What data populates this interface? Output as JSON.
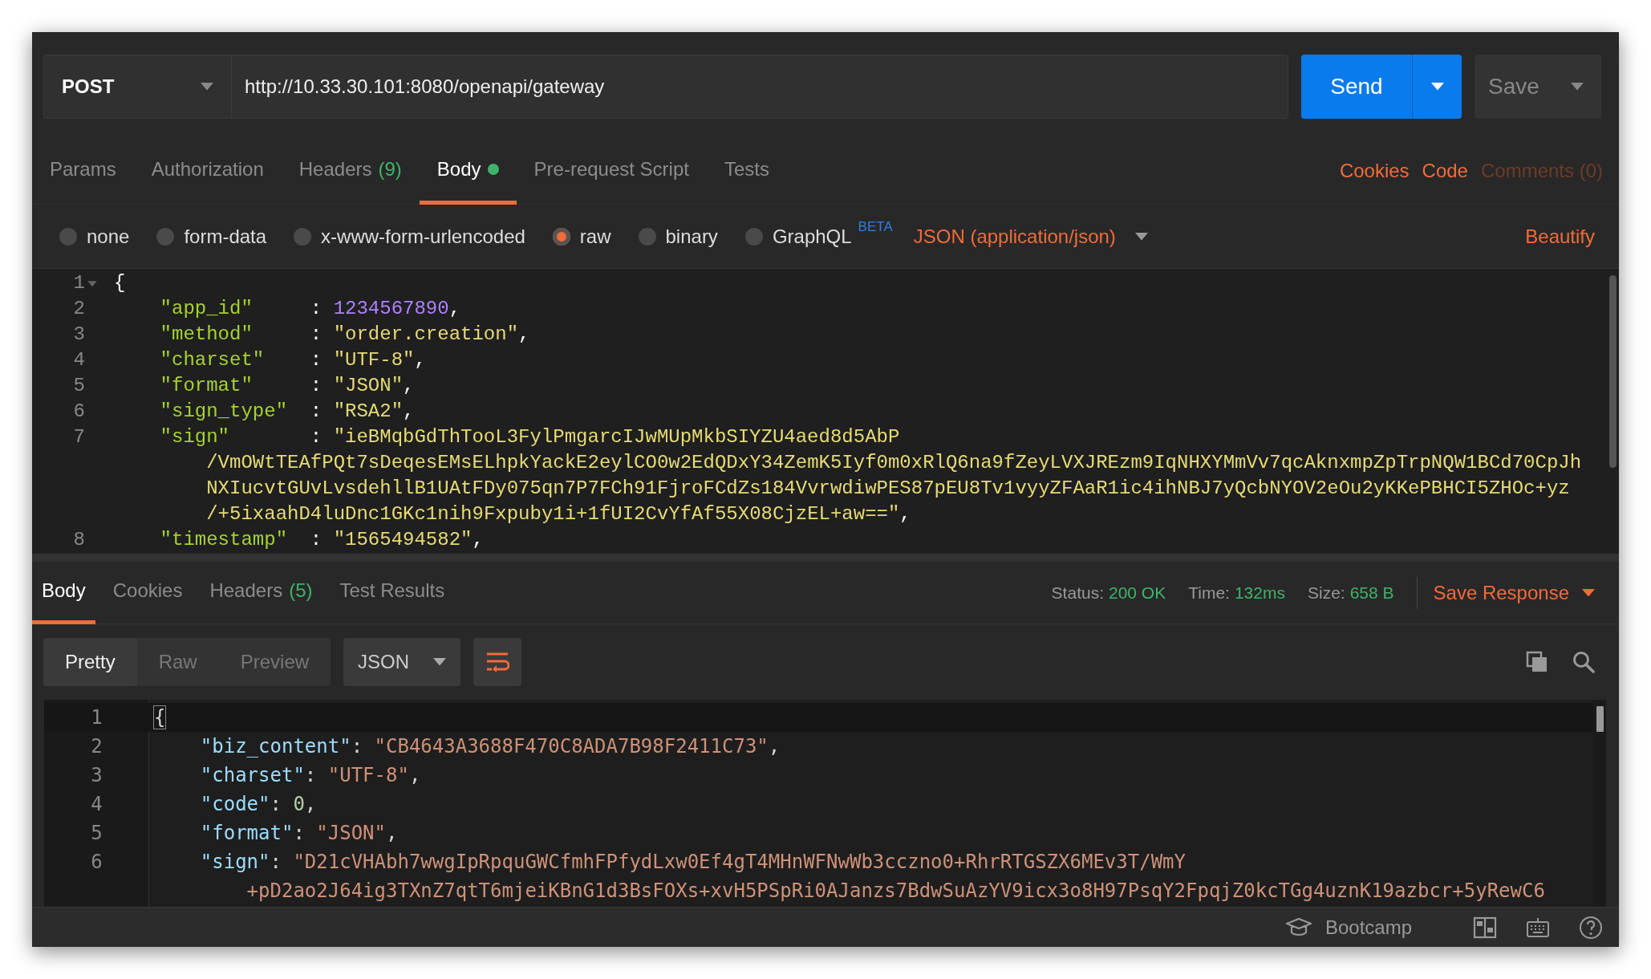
{
  "request": {
    "method": "POST",
    "url": "http://10.33.30.101:8080/openapi/gateway",
    "send": "Send",
    "save": "Save"
  },
  "request_tabs": [
    {
      "label": "Params",
      "selected": false
    },
    {
      "label": "Authorization",
      "selected": false
    },
    {
      "label": "Headers",
      "count": "(9)",
      "selected": false
    },
    {
      "label": "Body",
      "indicator": true,
      "selected": true
    },
    {
      "label": "Pre-request Script",
      "selected": false
    },
    {
      "label": "Tests",
      "selected": false
    }
  ],
  "request_links": [
    {
      "label": "Cookies",
      "disabled": false
    },
    {
      "label": "Code",
      "disabled": false
    },
    {
      "label": "Comments (0)",
      "disabled": true
    }
  ],
  "body_modes": [
    {
      "label": "none",
      "selected": false
    },
    {
      "label": "form-data",
      "selected": false
    },
    {
      "label": "x-www-form-urlencoded",
      "selected": false
    },
    {
      "label": "raw",
      "selected": true
    },
    {
      "label": "binary",
      "selected": false
    },
    {
      "label": "GraphQL",
      "badge": "BETA",
      "selected": false
    }
  ],
  "content_type": "JSON (application/json)",
  "beautify": "Beautify",
  "request_body": [
    {
      "number": "1",
      "foldable": true,
      "tokens": [
        {
          "kind": "brace",
          "text": "{"
        }
      ],
      "children": [
        {
          "number": "2",
          "tokens": [
            {
              "kind": "key",
              "text": "\"app_id\""
            },
            {
              "kind": "colon",
              "text": ":"
            },
            {
              "kind": "number",
              "text": "1234567890"
            },
            {
              "kind": "punct",
              "text": ","
            }
          ]
        },
        {
          "number": "3",
          "tokens": [
            {
              "kind": "key",
              "text": "\"method\""
            },
            {
              "kind": "colon",
              "text": ":"
            },
            {
              "kind": "string",
              "text": "\"order.creation\""
            },
            {
              "kind": "punct",
              "text": ","
            }
          ]
        },
        {
          "number": "4",
          "tokens": [
            {
              "kind": "key",
              "text": "\"charset\""
            },
            {
              "kind": "colon",
              "text": ":"
            },
            {
              "kind": "string",
              "text": "\"UTF-8\""
            },
            {
              "kind": "punct",
              "text": ","
            }
          ]
        },
        {
          "number": "5",
          "tokens": [
            {
              "kind": "key",
              "text": "\"format\""
            },
            {
              "kind": "colon",
              "text": ":"
            },
            {
              "kind": "string",
              "text": "\"JSON\""
            },
            {
              "kind": "punct",
              "text": ","
            }
          ]
        },
        {
          "number": "6",
          "tokens": [
            {
              "kind": "key",
              "text": "\"sign_type\""
            },
            {
              "kind": "colon",
              "text": ":"
            },
            {
              "kind": "string",
              "text": "\"RSA2\""
            },
            {
              "kind": "punct",
              "text": ","
            }
          ]
        },
        {
          "number": "7",
          "tokens": [
            {
              "kind": "key",
              "text": "\"sign\""
            },
            {
              "kind": "colon",
              "text": ":"
            },
            {
              "kind": "string",
              "text": "\"ieBMqbGdThTooL3FylPmgarcIJwMUpMkbSIYZU4aed8d5AbP"
            }
          ],
          "continuation": [
            {
              "tokens": [
                {
                  "kind": "string",
                  "text": "/VmOWtTEAfPQt7sDeqesEMsELhpkYackE2eylCO0w2EdQDxY34ZemK5Iyf0m0xRlQ6na9fZeyLVXJREzm9IqNHXYMmVv7qcAknxmpZpTrpNQW1BCd70CpJh"
                }
              ]
            },
            {
              "tokens": [
                {
                  "kind": "string",
                  "text": "NXIucvtGUvLvsdehllB1UAtFDy075qn7P7FCh91FjroFCdZs184VvrwdiwPES87pEU8Tv1vyyZFAaR1ic4ihNBJ7yQcbNYOV2eOu2yKKePBHCI5ZHOc+yz"
                }
              ]
            },
            {
              "tokens": [
                {
                  "kind": "string",
                  "text": "/+5ixaahD4luDnc1GKc1nih9Fxpuby1i+1fUI2CvYfAf55X08CjzEL+aw==\""
                },
                {
                  "kind": "punct",
                  "text": ","
                }
              ]
            }
          ]
        },
        {
          "number": "8",
          "tokens": [
            {
              "kind": "key",
              "text": "\"timestamp\""
            },
            {
              "kind": "colon",
              "text": ":"
            },
            {
              "kind": "string",
              "text": "\"1565494582\""
            },
            {
              "kind": "punct",
              "text": ","
            }
          ]
        }
      ]
    }
  ],
  "response_tabs": [
    {
      "label": "Body",
      "selected": true
    },
    {
      "label": "Cookies",
      "selected": false
    },
    {
      "label": "Headers",
      "count": "(5)",
      "selected": false
    },
    {
      "label": "Test Results",
      "selected": false
    }
  ],
  "response_meta": [
    {
      "label": "Status:",
      "value": "200 OK"
    },
    {
      "label": "Time:",
      "value": "132ms"
    },
    {
      "label": "Size:",
      "value": "658 B"
    }
  ],
  "save_response": "Save Response",
  "view_modes": [
    {
      "label": "Pretty",
      "selected": true
    },
    {
      "label": "Raw",
      "selected": false
    },
    {
      "label": "Preview",
      "selected": false
    }
  ],
  "format": "JSON",
  "wrap_lines": true,
  "response_body": [
    {
      "number": "1",
      "active": true,
      "tokens": [
        {
          "kind": "brace",
          "text": "{"
        }
      ],
      "children": [
        {
          "number": "2",
          "tokens": [
            {
              "kind": "key",
              "text": "\"biz_content\""
            },
            {
              "kind": "colon",
              "text": ":"
            },
            {
              "kind": "string",
              "text": "\"CB4643A3688F470C8ADA7B98F2411C73\""
            },
            {
              "kind": "punct",
              "text": ","
            }
          ]
        },
        {
          "number": "3",
          "tokens": [
            {
              "kind": "key",
              "text": "\"charset\""
            },
            {
              "kind": "colon",
              "text": ":"
            },
            {
              "kind": "string",
              "text": "\"UTF-8\""
            },
            {
              "kind": "punct",
              "text": ","
            }
          ]
        },
        {
          "number": "4",
          "tokens": [
            {
              "kind": "key",
              "text": "\"code\""
            },
            {
              "kind": "colon",
              "text": ":"
            },
            {
              "kind": "number",
              "text": "0"
            },
            {
              "kind": "punct",
              "text": ","
            }
          ]
        },
        {
          "number": "5",
          "tokens": [
            {
              "kind": "key",
              "text": "\"format\""
            },
            {
              "kind": "colon",
              "text": ":"
            },
            {
              "kind": "string",
              "text": "\"JSON\""
            },
            {
              "kind": "punct",
              "text": ","
            }
          ]
        },
        {
          "number": "6",
          "tokens": [
            {
              "kind": "key",
              "text": "\"sign\""
            },
            {
              "kind": "colon",
              "text": ":"
            },
            {
              "kind": "string",
              "text": "\"D21cVHAbh7wwgIpRpquGWCfmhFPfydLxw0Ef4gT4MHnWFNwWb3cczno0+RhrRTGSZX6MEv3T/WmY"
            }
          ],
          "continuation": [
            {
              "tokens": [
                {
                  "kind": "string",
                  "text": "+pD2ao2J64ig3TXnZ7qtT6mjeiKBnG1d3BsFOXs+xvH5PSpRi0AJanzs7BdwSuAzYV9icx3o8H97PsqY2FpqjZ0kcTGg4uznK19azbcr+5yRewC6"
                }
              ]
            }
          ]
        }
      ]
    }
  ],
  "footer": {
    "bootcamp": "Bootcamp"
  }
}
